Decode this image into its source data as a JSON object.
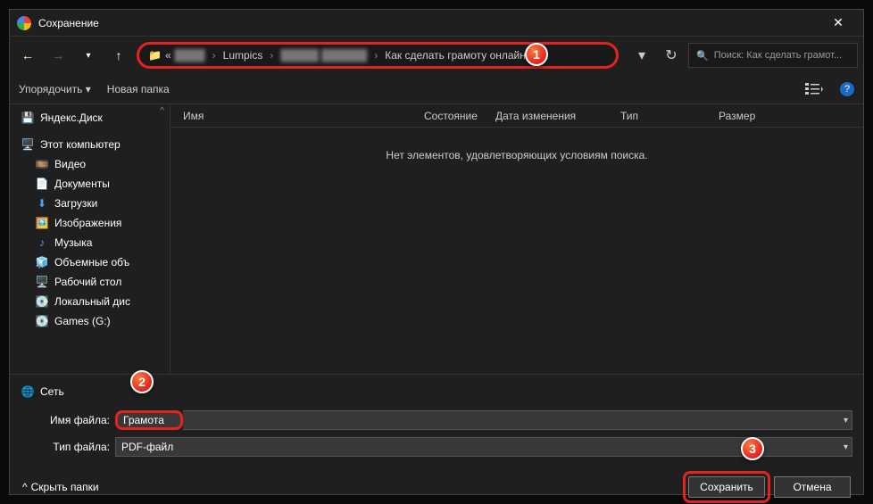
{
  "window": {
    "title": "Сохранение"
  },
  "breadcrumb": {
    "prefix": "«",
    "parts": [
      "Lumpics",
      "Как сделать грамоту онлайн"
    ],
    "blurred_segments": 2
  },
  "search": {
    "placeholder": "Поиск: Как сделать грамот..."
  },
  "toolbar": {
    "organize": "Упорядочить",
    "new_folder": "Новая папка"
  },
  "columns": {
    "name": "Имя",
    "state": "Состояние",
    "date": "Дата изменения",
    "type": "Тип",
    "size": "Размер"
  },
  "empty_message": "Нет элементов, удовлетворяющих условиям поиска.",
  "sidebar": {
    "yandex": "Яндекс.Диск",
    "this_pc": "Этот компьютер",
    "items": [
      "Видео",
      "Документы",
      "Загрузки",
      "Изображения",
      "Музыка",
      "Объемные объ",
      "Рабочий стол",
      "Локальный дис",
      "Games (G:)"
    ],
    "network": "Сеть"
  },
  "fields": {
    "filename_label": "Имя файла:",
    "filename_value": "Грамота",
    "filetype_label": "Тип файла:",
    "filetype_value": "PDF-файл"
  },
  "footer": {
    "hide_folders": "Скрыть папки",
    "save": "Сохранить",
    "cancel": "Отмена"
  },
  "callouts": {
    "one": "1",
    "two": "2",
    "three": "3"
  }
}
